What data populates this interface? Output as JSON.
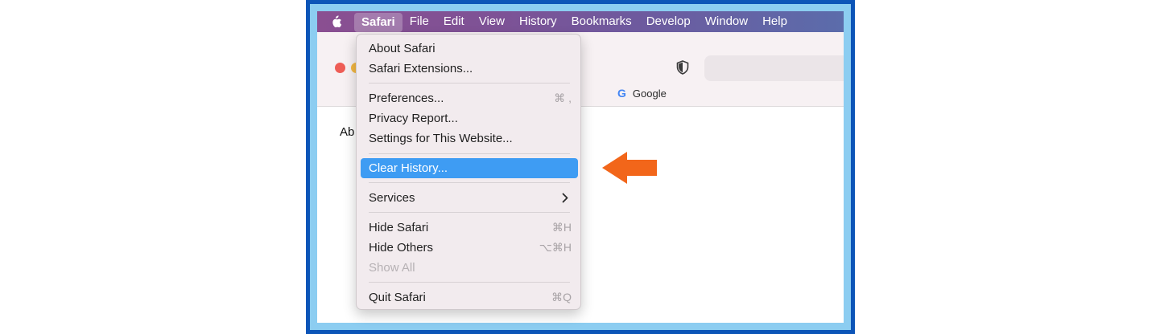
{
  "menubar": {
    "apple_icon": "apple-icon",
    "items": [
      {
        "label": "Safari",
        "active": true
      },
      {
        "label": "File"
      },
      {
        "label": "Edit"
      },
      {
        "label": "View"
      },
      {
        "label": "History"
      },
      {
        "label": "Bookmarks"
      },
      {
        "label": "Develop"
      },
      {
        "label": "Window"
      },
      {
        "label": "Help"
      }
    ]
  },
  "browser": {
    "favorites": [
      {
        "label": "Google",
        "icon": "google-icon"
      }
    ],
    "page_text": "Ab",
    "shield_icon": "shield-icon"
  },
  "safari_menu": {
    "items": [
      {
        "label": "About Safari",
        "shortcut": ""
      },
      {
        "label": "Safari Extensions...",
        "shortcut": ""
      },
      {
        "label": "Preferences...",
        "shortcut": "⌘ ,"
      },
      {
        "label": "Privacy Report...",
        "shortcut": ""
      },
      {
        "label": "Settings for This Website...",
        "shortcut": ""
      },
      {
        "label": "Clear History...",
        "shortcut": "",
        "highlighted": true
      },
      {
        "label": "Services",
        "shortcut": "",
        "submenu": true
      },
      {
        "label": "Hide Safari",
        "shortcut": "⌘H"
      },
      {
        "label": "Hide Others",
        "shortcut": "⌥⌘H"
      },
      {
        "label": "Show All",
        "shortcut": "",
        "disabled": true
      },
      {
        "label": "Quit Safari",
        "shortcut": "⌘Q"
      }
    ]
  },
  "colors": {
    "highlight": "#3e9cf3",
    "arrow": "#f2661a",
    "frame": "#0c55b8"
  }
}
